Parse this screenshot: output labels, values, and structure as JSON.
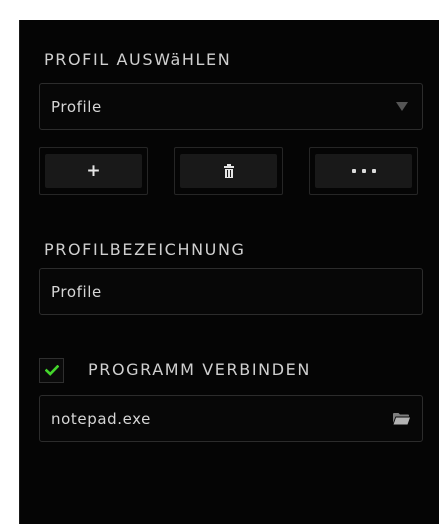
{
  "select_profile": {
    "heading": "PROFIL AUSWäHLEN",
    "dropdown_value": "Profile",
    "add_label": "+"
  },
  "profile_name": {
    "heading": "PROFILBEZEICHNUNG",
    "value": "Profile"
  },
  "link_program": {
    "checked": true,
    "label": "PROGRAMM VERBINDEN",
    "path_value": "notepad.exe"
  },
  "icons": {
    "dropdown": "chevron-down-icon",
    "delete": "trash-icon",
    "more": "more-dots-icon",
    "check": "checkmark-icon",
    "browse": "folder-icon"
  },
  "colors": {
    "background": "#050505",
    "text": "#cfcfcf",
    "accent_check": "#44d62c",
    "button_fill": "#191919"
  }
}
